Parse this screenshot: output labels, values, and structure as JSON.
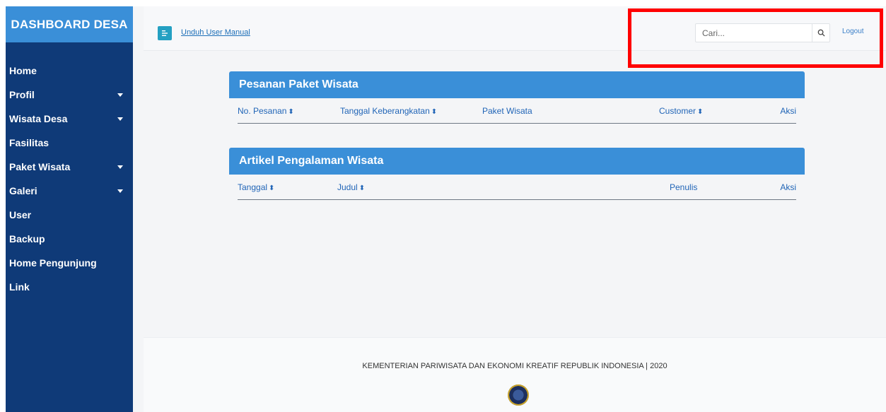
{
  "sidebar": {
    "brand": "DASHBOARD DESA",
    "items": [
      {
        "label": "Home",
        "caret": false
      },
      {
        "label": "Profil",
        "caret": true
      },
      {
        "label": "Wisata Desa",
        "caret": true
      },
      {
        "label": "Fasilitas",
        "caret": false
      },
      {
        "label": "Paket Wisata",
        "caret": true
      },
      {
        "label": "Galeri",
        "caret": true
      },
      {
        "label": "User",
        "caret": false
      },
      {
        "label": "Backup",
        "caret": false
      },
      {
        "label": "Home Pengunjung",
        "caret": false
      },
      {
        "label": "Link",
        "caret": false
      }
    ]
  },
  "topbar": {
    "manual_link": "Unduh User Manual",
    "search_placeholder": "Cari...",
    "logout": "Logout"
  },
  "pesanan": {
    "title": "Pesanan Paket Wisata",
    "columns": [
      "No. Pesanan",
      "Tanggal Keberangkatan",
      "Paket Wisata",
      "Customer",
      "Aksi"
    ],
    "sortable": [
      true,
      true,
      false,
      true,
      false
    ]
  },
  "artikel": {
    "title": "Artikel Pengalaman Wisata",
    "columns": [
      "Tanggal",
      "Judul",
      "Penulis",
      "Aksi"
    ],
    "sortable": [
      true,
      true,
      false,
      false
    ]
  },
  "footer": {
    "text": "KEMENTERIAN PARIWISATA DAN EKONOMI KREATIF REPUBLIK INDONESIA | 2020"
  },
  "colors": {
    "sidebar_bg": "#0f3a78",
    "brand_bg": "#3a8fd8",
    "panel_header": "#3a8fd8",
    "link": "#2165b7",
    "highlight": "#ff0000"
  }
}
